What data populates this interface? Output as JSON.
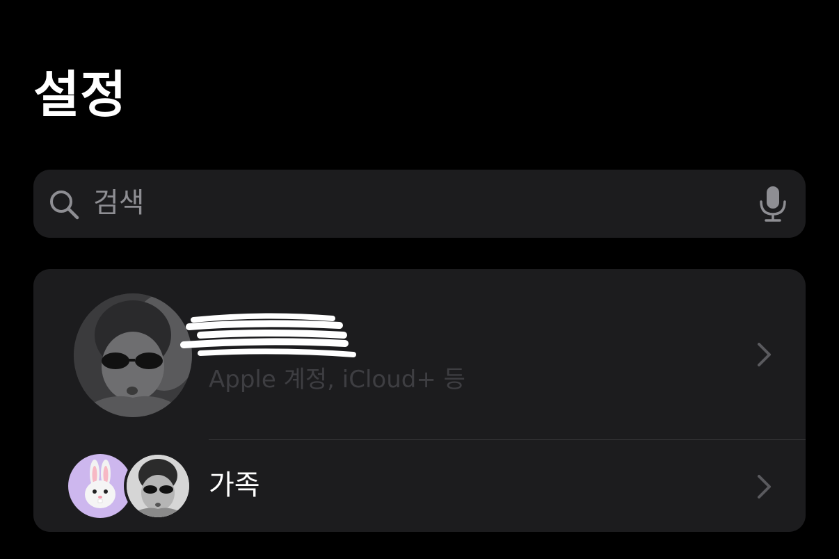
{
  "header": {
    "title": "설정"
  },
  "search": {
    "placeholder": "검색",
    "search_icon": "magnifying-glass-icon",
    "mic_icon": "microphone-icon"
  },
  "account_row": {
    "name": "",
    "subtitle": "Apple 계정, iCloud+ 등",
    "avatar": "profile-photo",
    "chevron_icon": "chevron-right-icon"
  },
  "family_row": {
    "label": "가족",
    "avatars": [
      "bunny-memoji",
      "profile-photo"
    ],
    "chevron_icon": "chevron-right-icon"
  },
  "colors": {
    "background": "#000000",
    "card": "#1c1c1e",
    "secondary_text": "#8e8e93",
    "bunny_avatar_bg": "#cdb7ee"
  }
}
